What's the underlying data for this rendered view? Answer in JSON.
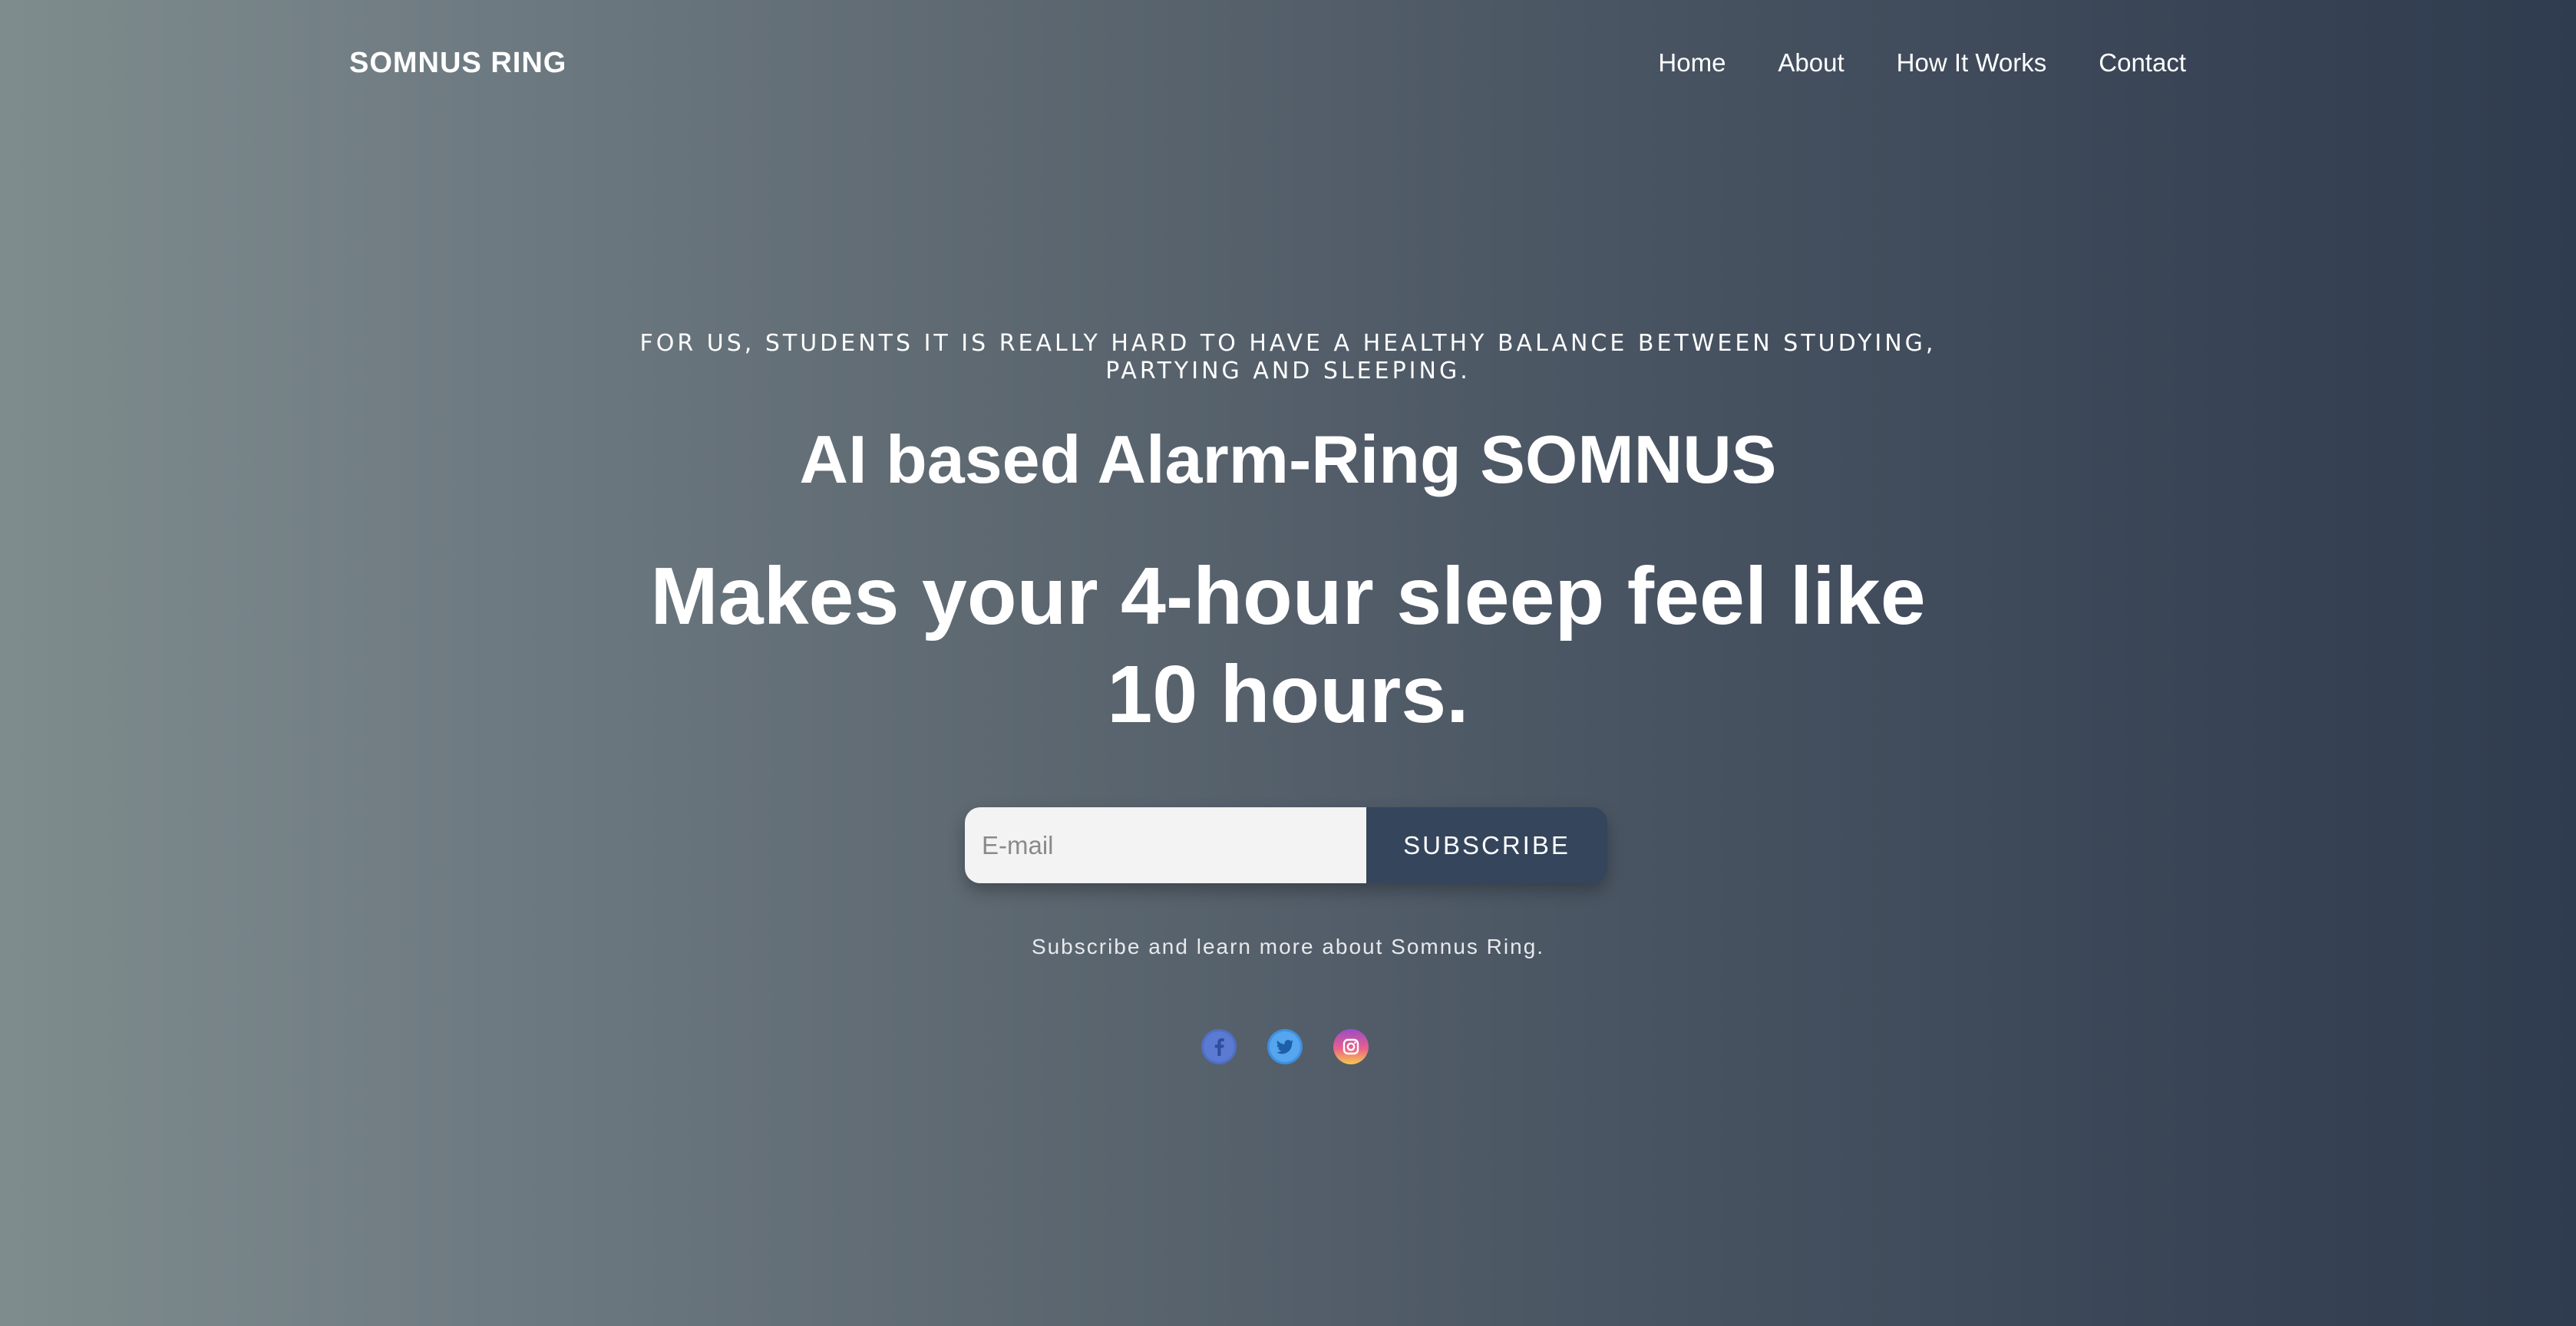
{
  "brand": "SOMNUS RING",
  "nav": {
    "items": [
      {
        "label": "Home"
      },
      {
        "label": "About"
      },
      {
        "label": "How It Works"
      },
      {
        "label": "Contact"
      }
    ]
  },
  "hero": {
    "tagline": "FOR US, STUDENTS IT IS REALLY HARD TO HAVE A HEALTHY BALANCE BETWEEN STUDYING, PARTYING AND SLEEPING.",
    "headline1": "AI based Alarm-Ring SOMNUS",
    "headline2": "Makes your 4-hour sleep feel like 10 hours."
  },
  "subscribe": {
    "placeholder": "E-mail",
    "button_label": "SUBSCRIBE",
    "note": "Subscribe and learn more about Somnus Ring."
  },
  "social": {
    "icons": [
      "facebook-icon",
      "twitter-icon",
      "instagram-icon"
    ]
  },
  "colors": {
    "gradient_start": "#7f8c8d",
    "gradient_end": "#2f3c4f",
    "button": "#34455c",
    "input_bg": "#f3f3f3"
  }
}
